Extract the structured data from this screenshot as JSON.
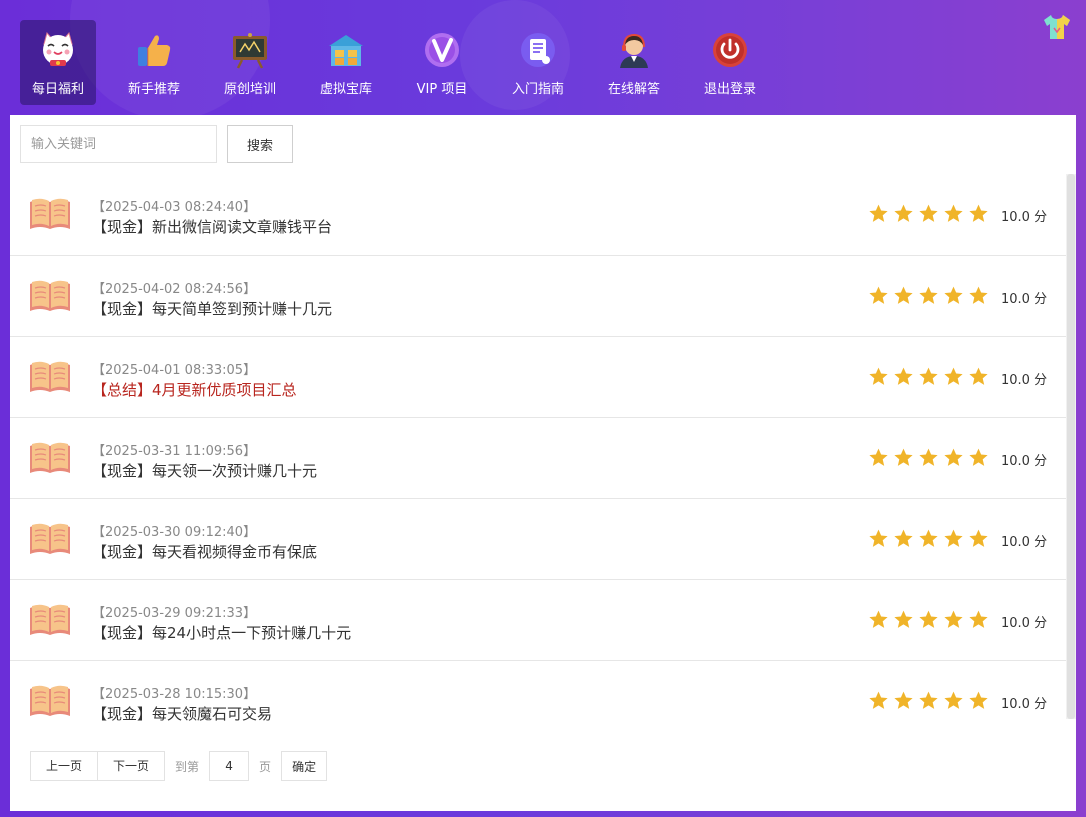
{
  "nav": {
    "items": [
      {
        "label": "每日福利",
        "icon": "lucky-cat-icon",
        "active": true
      },
      {
        "label": "新手推荐",
        "icon": "thumbs-up-icon"
      },
      {
        "label": "原创培训",
        "icon": "blackboard-icon"
      },
      {
        "label": "虚拟宝库",
        "icon": "treasury-icon"
      },
      {
        "label": "VIP 项目",
        "icon": "vip-icon"
      },
      {
        "label": "入门指南",
        "icon": "guide-document-icon"
      },
      {
        "label": "在线解答",
        "icon": "support-agent-icon"
      },
      {
        "label": "退出登录",
        "icon": "power-icon"
      }
    ],
    "skin_icon": "tshirt-icon"
  },
  "search": {
    "placeholder": "输入关键词",
    "button_label": "搜索"
  },
  "list": {
    "rating_stars": 5,
    "items": [
      {
        "date": "【2025-04-03 08:24:40】",
        "title": "【现金】新出微信阅读文章赚钱平台",
        "score": "10.0 分",
        "highlight": false
      },
      {
        "date": "【2025-04-02 08:24:56】",
        "title": "【现金】每天简单签到预计赚十几元",
        "score": "10.0 分",
        "highlight": false
      },
      {
        "date": "【2025-04-01 08:33:05】",
        "title": "【总结】4月更新优质项目汇总",
        "score": "10.0 分",
        "highlight": true
      },
      {
        "date": "【2025-03-31 11:09:56】",
        "title": "【现金】每天领一次预计赚几十元",
        "score": "10.0 分",
        "highlight": false
      },
      {
        "date": "【2025-03-30 09:12:40】",
        "title": "【现金】每天看视频得金币有保底",
        "score": "10.0 分",
        "highlight": false
      },
      {
        "date": "【2025-03-29 09:21:33】",
        "title": "【现金】每24小时点一下预计赚几十元",
        "score": "10.0 分",
        "highlight": false
      },
      {
        "date": "【2025-03-28 10:15:30】",
        "title": "【现金】每天领魔石可交易",
        "score": "10.0 分",
        "highlight": false
      }
    ]
  },
  "pager": {
    "prev_label": "上一页",
    "next_label": "下一页",
    "goto_prefix": "到第",
    "page_value": "4",
    "goto_suffix": "页",
    "confirm_label": "确定"
  },
  "colors": {
    "star": "#f0b429",
    "highlight_title": "#b8251e",
    "book_cover": "#e88a7a",
    "book_pages": "#f7c48a"
  }
}
